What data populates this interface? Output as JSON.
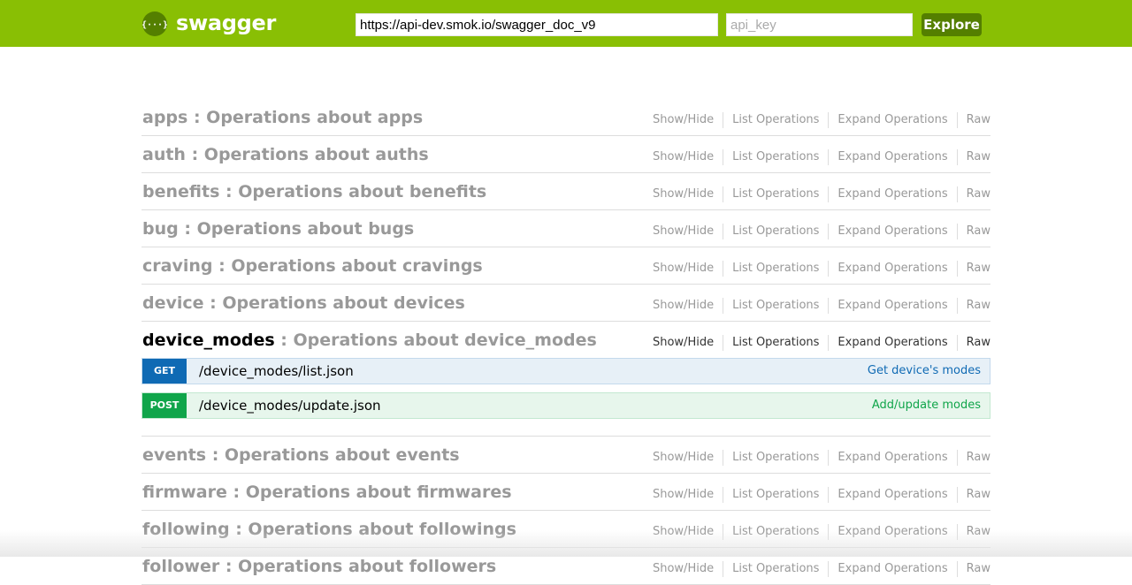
{
  "header": {
    "logo_text": "swagger",
    "url_value": "https://api-dev.smok.io/swagger_doc_v9",
    "api_key_placeholder": "api_key",
    "explore_label": "Explore"
  },
  "colors": {
    "header_bg": "#89bf04",
    "accent_dark": "#547f00",
    "get": "#0f6ab4",
    "post": "#10a54a"
  },
  "links": {
    "show_hide": "Show/Hide",
    "list_operations": "List Operations",
    "expand_operations": "Expand Operations",
    "raw": "Raw"
  },
  "resources": [
    {
      "name": "apps",
      "sep": " : ",
      "desc": "Operations about apps"
    },
    {
      "name": "auth",
      "sep": " : ",
      "desc": "Operations about auths"
    },
    {
      "name": "benefits",
      "sep": " : ",
      "desc": "Operations about benefits"
    },
    {
      "name": "bug",
      "sep": " : ",
      "desc": "Operations about bugs"
    },
    {
      "name": "craving",
      "sep": " : ",
      "desc": "Operations about cravings"
    },
    {
      "name": "device",
      "sep": " : ",
      "desc": "Operations about devices"
    },
    {
      "name": "device_modes",
      "sep": " : ",
      "desc": "Operations about device_modes",
      "expanded": true,
      "operations": [
        {
          "method": "GET",
          "path": "/device_modes/list.json",
          "summary": "Get device's modes"
        },
        {
          "method": "POST",
          "path": "/device_modes/update.json",
          "summary": "Add/update modes"
        }
      ]
    },
    {
      "name": "events",
      "sep": " : ",
      "desc": "Operations about events"
    },
    {
      "name": "firmware",
      "sep": " : ",
      "desc": "Operations about firmwares"
    },
    {
      "name": "following",
      "sep": " : ",
      "desc": "Operations about followings"
    },
    {
      "name": "follower",
      "sep": " : ",
      "desc": "Operations about followers"
    }
  ]
}
